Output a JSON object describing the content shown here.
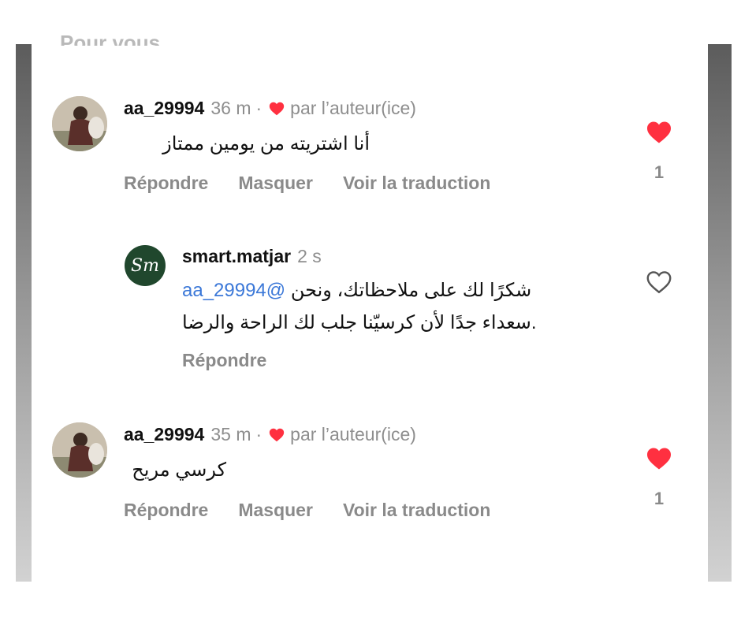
{
  "header": {
    "cutoff_text": "Pour vous"
  },
  "comments": [
    {
      "username": "aa_29994",
      "time": "36 m",
      "separator": "·",
      "liked_by_author": "par l’auteur(ice)",
      "text": "أنا اشتريته من يومين ممتاز",
      "actions": {
        "reply": "Répondre",
        "hide": "Masquer",
        "translate": "Voir la traduction"
      },
      "like_count": "1",
      "liked": true
    },
    {
      "username": "smart.matjar",
      "time": "2 s",
      "avatar_initials": "Sm",
      "mention": "@aa_29994",
      "text_line1": "شكرًا لك على ملاحظاتك، ونحن",
      "text_line2": ".سعداء جدًا لأن كرسيّنا جلب لك الراحة والرضا",
      "actions": {
        "reply": "Répondre"
      },
      "liked": false
    },
    {
      "username": "aa_29994",
      "time": "35 m",
      "separator": "·",
      "liked_by_author": "par l’auteur(ice)",
      "text": "كرسي مريح",
      "actions": {
        "reply": "Répondre",
        "hide": "Masquer",
        "translate": "Voir la traduction"
      },
      "like_count": "1",
      "liked": true
    }
  ],
  "colors": {
    "heart_red": "#ff3040",
    "brand_green": "#20472d",
    "mention_blue": "#3b78d8",
    "muted_gray": "#8e8e8e"
  },
  "icons": {
    "like_filled": "heart-filled-icon",
    "like_outline": "heart-outline-icon"
  }
}
